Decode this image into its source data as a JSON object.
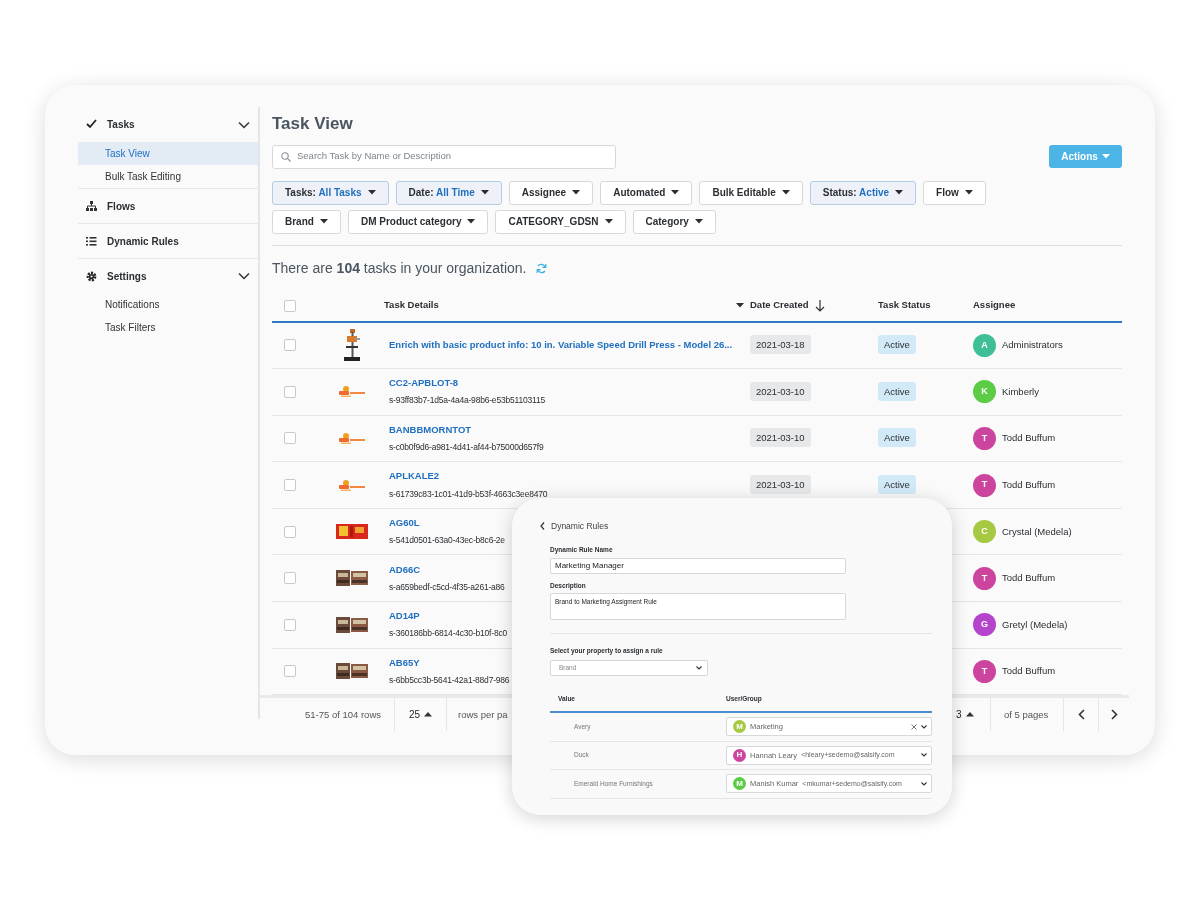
{
  "sidebar": {
    "sections": [
      {
        "kind": "group",
        "label": "Tasks",
        "expanded": true,
        "children": [
          {
            "label": "Task View",
            "selected": true
          },
          {
            "label": "Bulk Task Editing",
            "selected": false
          }
        ]
      },
      {
        "kind": "link",
        "label": "Flows"
      },
      {
        "kind": "link",
        "label": "Dynamic Rules"
      },
      {
        "kind": "group",
        "label": "Settings",
        "expanded": true,
        "children": [
          {
            "label": "Notifications",
            "selected": false
          },
          {
            "label": "Task Filters",
            "selected": false
          }
        ]
      }
    ]
  },
  "main": {
    "title": "Task View",
    "search": {
      "placeholder": "Search Task by Name or Description"
    },
    "actions_button": "Actions",
    "filters": [
      {
        "label": "Tasks:",
        "value": "All Tasks",
        "active": true
      },
      {
        "label": "Date:",
        "value": "All Time",
        "active": true
      },
      {
        "label": "Assignee",
        "active": false
      },
      {
        "label": "Automated",
        "active": false
      },
      {
        "label": "Bulk Editable",
        "active": false
      },
      {
        "label": "Status:",
        "value": "Active",
        "active": true
      },
      {
        "label": "Flow",
        "active": false
      },
      {
        "label": "Brand",
        "active": false
      },
      {
        "label": "DM Product category",
        "active": false
      },
      {
        "label": "CATEGORY_GDSN",
        "active": false
      },
      {
        "label": "Category",
        "active": false
      }
    ],
    "summary": "There are **104** tasks in your organization.",
    "table": {
      "select_all": {
        "checked": false
      },
      "columns": [
        "Task Details",
        "Date Created",
        "Task Status",
        "Assignee"
      ],
      "rows": [
        {
          "checked": false,
          "title": "Enrich with basic product info: 10 in. Variable Speed Drill Press - Model 26...",
          "date": "2021-03-18",
          "status": "Active",
          "assignee": {
            "initial": "A",
            "name": "Administrators",
            "color": "#3fbf98"
          }
        },
        {
          "checked": false,
          "title": "CC2-APBLOT-8",
          "id": "s-93ff83b7-1d5a-4a4a-98b6-e53b51103115",
          "date": "2021-03-10",
          "status": "Active",
          "assignee": {
            "initial": "K",
            "name": "Kimberly",
            "color": "#5ccb45"
          }
        },
        {
          "checked": false,
          "title": "BANBBMORNTOT",
          "id": "s-c0b0f9d6-a981-4d41-af44-b75000d657f9",
          "date": "2021-03-10",
          "status": "Active",
          "assignee": {
            "initial": "T",
            "name": "Todd Buffum",
            "color": "#cc449e"
          }
        },
        {
          "checked": false,
          "title": "APLKALE2",
          "id": "s-61739c83-1c01-41d9-b53f-4663c3ee8470",
          "date": "2021-03-10",
          "status": "Active",
          "assignee": {
            "initial": "T",
            "name": "Todd Buffum",
            "color": "#cc449e"
          }
        },
        {
          "checked": false,
          "title": "AG60L",
          "id": "s-541d0501-63a0-43ec-b8c6-2e",
          "assignee": {
            "initial": "C",
            "name": "Crystal (Medela)",
            "color": "#a6c944"
          }
        },
        {
          "checked": false,
          "title": "AD66C",
          "id": "s-a659bedf-c5cd-4f35-a261-a86",
          "assignee": {
            "initial": "T",
            "name": "Todd Buffum",
            "color": "#cc449e"
          }
        },
        {
          "checked": false,
          "title": "AD14P",
          "id": "s-360186bb-6814-4c30-b10f-8c0",
          "assignee": {
            "initial": "G",
            "name": "Gretyl (Medela)",
            "color": "#b444cc"
          }
        },
        {
          "checked": false,
          "title": "AB65Y",
          "id": "s-6bb5cc3b-5641-42a1-88d7-986",
          "assignee": {
            "initial": "T",
            "name": "Todd Buffum",
            "color": "#cc449e"
          }
        }
      ]
    },
    "pagination": {
      "range": "51-75 of 104 rows",
      "per_page": "25",
      "per_page_label": "rows per pa",
      "page": "3",
      "pages_label": "of 5 pages"
    }
  },
  "rule_panel": {
    "back": "Dynamic Rules",
    "name_label": "Dynamic Rule Name",
    "name_value": "Marketing Manager",
    "description_label": "Description",
    "description_value": "Brand to Marketing Assigment Rule",
    "property_label": "Select your property to assign a rule",
    "property_value": "Brand",
    "columns": [
      "Value",
      "User/Group"
    ],
    "rows": [
      {
        "value": "Avery",
        "assignee": {
          "initial": "M",
          "name": "Marketing",
          "color": "#a6c944",
          "clearable": true
        }
      },
      {
        "value": "Duck",
        "assignee": {
          "initial": "H",
          "name": "Hannah Leary",
          "email": "<hleary+sedemo@salsify.com",
          "color": "#cc449e",
          "clearable": false
        }
      },
      {
        "value": "Emerald Home Furnishings",
        "assignee": {
          "initial": "M",
          "name": "Manish Kumar",
          "email": "<mkumar+sedemo@salsify.com",
          "color": "#5ccb45",
          "clearable": false
        }
      }
    ]
  }
}
